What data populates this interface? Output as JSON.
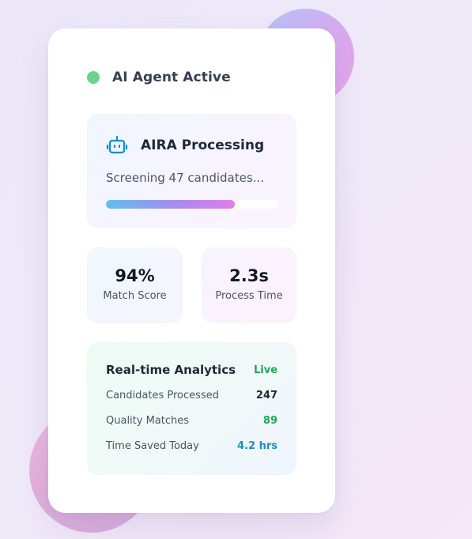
{
  "status": {
    "label": "AI Agent Active",
    "dot_color": "#68d391"
  },
  "processing": {
    "icon": "robot-icon",
    "title": "AIRA Processing",
    "subtitle": "Screening 47 candidates...",
    "progress_fraction": 0.75
  },
  "stats": [
    {
      "value": "94%",
      "label": "Match Score"
    },
    {
      "value": "2.3s",
      "label": "Process Time"
    }
  ],
  "analytics": {
    "title": "Real-time Analytics",
    "badge": "Live",
    "badge_color": "#22a55a",
    "rows": [
      {
        "label": "Candidates Processed",
        "value": "247",
        "color": "#1f2937"
      },
      {
        "label": "Quality Matches",
        "value": "89",
        "color": "#22a55a"
      },
      {
        "label": "Time Saved Today",
        "value": "4.2 hrs",
        "color": "#1e90c0"
      }
    ]
  },
  "colors": {
    "accent_blue": "#0b8fd3",
    "progress_start": "#63bfee",
    "progress_end": "#e27ee9"
  }
}
